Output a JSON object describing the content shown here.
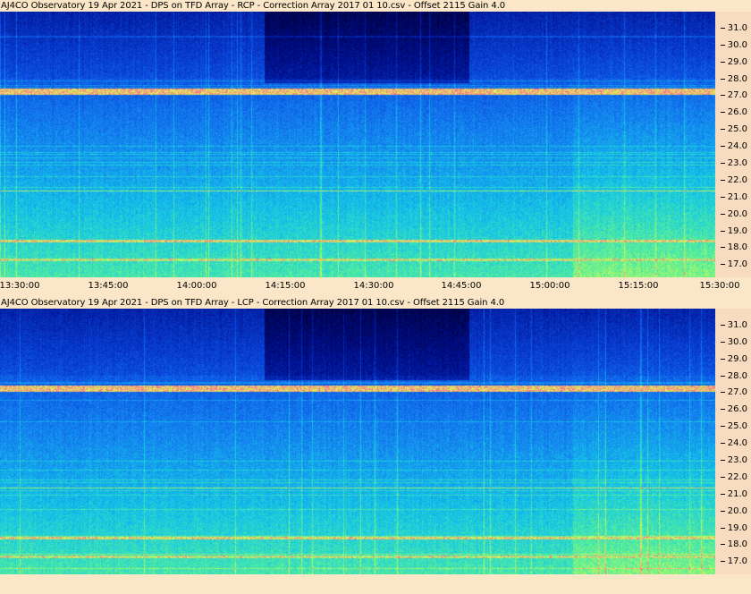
{
  "panels": [
    {
      "title": "AJ4CO Observatory 19 Apr 2021  -  DPS on TFD Array  -  RCP  -  Correction Array 2017 01 10.csv  -  Offset 2115  Gain 4.0",
      "polarization": "RCP"
    },
    {
      "title": "AJ4CO Observatory 19 Apr 2021  -  DPS on TFD Array  -  LCP  -  Correction Array 2017 01 10.csv  -  Offset 2115  Gain 4.0",
      "polarization": "LCP"
    }
  ],
  "x_axis": {
    "labels": [
      "13:30:00",
      "13:45:00",
      "14:00:00",
      "14:15:00",
      "14:30:00",
      "14:45:00",
      "15:00:00",
      "15:15:00",
      "15:30:00"
    ]
  },
  "y_axis": {
    "labels": [
      "31.0",
      "30.0",
      "29.0",
      "28.0",
      "27.0",
      "26.0",
      "25.0",
      "24.0",
      "23.0",
      "22.0",
      "21.0",
      "20.0",
      "19.0",
      "18.0",
      "17.0"
    ]
  },
  "colors": {
    "background": "#fbe6c8",
    "axis_strip": "#f7dcc0"
  }
}
